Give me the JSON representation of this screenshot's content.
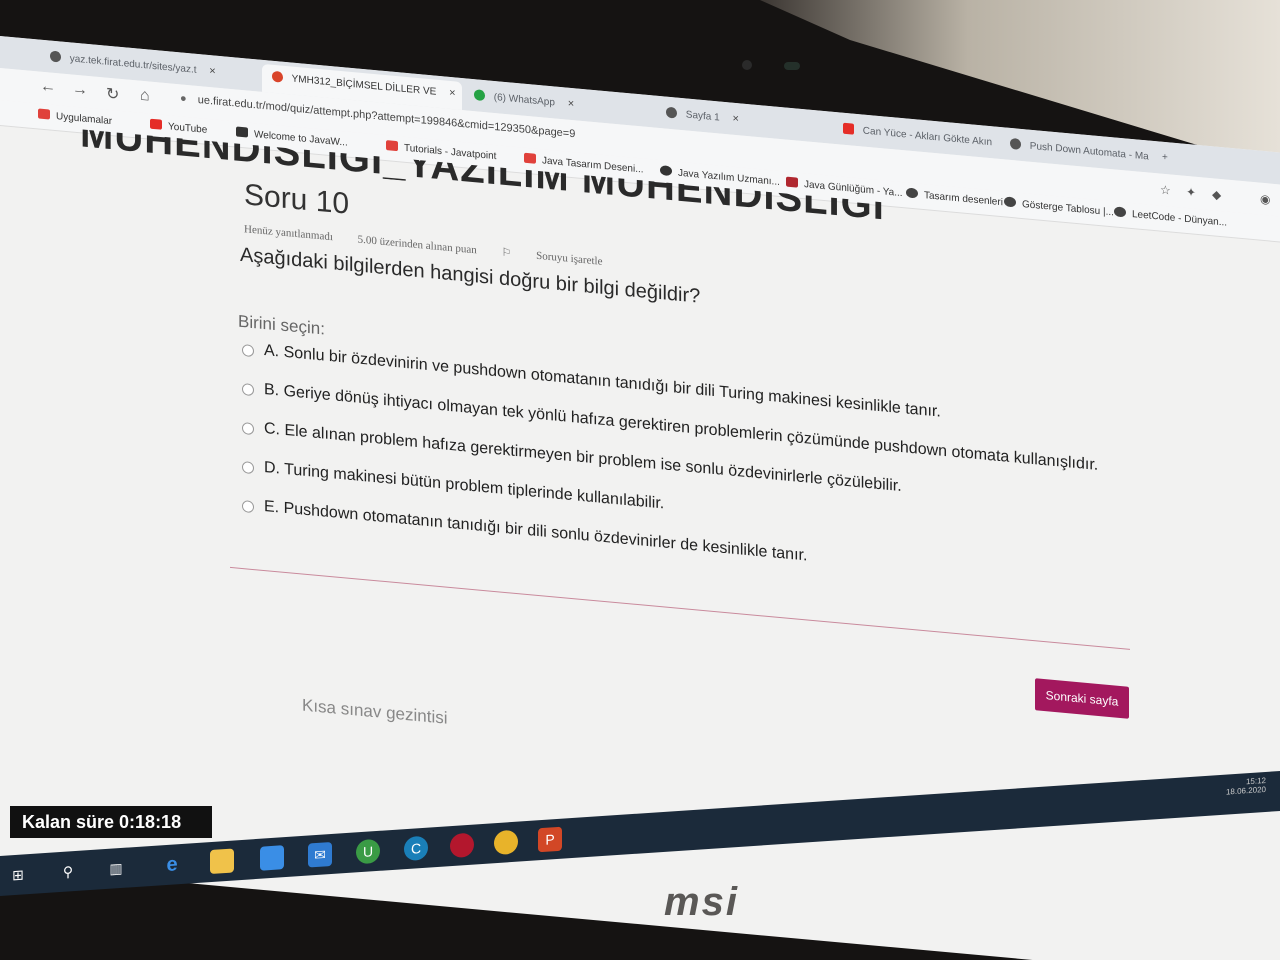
{
  "browser": {
    "tabs": [
      {
        "label": "yaz.tek.firat.edu.tr/sites/yaz.t",
        "active": false
      },
      {
        "label": "YMH312_BİÇİMSEL DİLLER VE",
        "active": true
      },
      {
        "label": "(6) WhatsApp",
        "active": false
      },
      {
        "label": "Sayfa 1",
        "active": false
      },
      {
        "label": "Can Yüce - Akları Gökte Akın",
        "active": false
      },
      {
        "label": "Push Down Automata - Ma",
        "active": false
      }
    ],
    "url": "ue.firat.edu.tr/mod/quiz/attempt.php?attempt=199846&cmid=129350&page=9",
    "bookmarks": [
      "Uygulamalar",
      "YouTube",
      "Welcome to JavaW...",
      "Tutorials - Javatpoint",
      "Java Tasarım Deseni...",
      "Java Yazılım Uzmanı...",
      "Java Günlüğüm - Ya...",
      "Tasarım desenleri",
      "Gösterge Tablosu |...",
      "LeetCode - Dünyan..."
    ]
  },
  "page": {
    "header_partial": "MÜHENDİSLİĞİ_YAZILIM MÜHENDİSLİĞİ",
    "question_number": "Soru 10",
    "status": "Henüz yanıtlanmadı",
    "points": "5.00 üzerinden alınan puan",
    "flag": "Soruyu işaretle",
    "question_text": "Aşağıdaki bilgilerden hangisi doğru bir bilgi değildir?",
    "prompt": "Birini seçin:",
    "answers": [
      "A. Sonlu bir özdevinirin ve pushdown otomatanın tanıdığı bir dili Turing makinesi kesinlikle tanır.",
      "B. Geriye dönüş ihtiyacı olmayan tek yönlü hafıza gerektiren problemlerin çözümünde pushdown otomata kullanışlıdır.",
      "C. Ele alınan problem hafıza gerektirmeyen bir problem ise sonlu özdevinirlerle çözülebilir.",
      "D. Turing makinesi bütün problem tiplerinde kullanılabilir.",
      "E. Pushdown otomatanın tanıdığı bir dili sonlu özdevinirler de kesinlikle tanır."
    ],
    "next_button": "Sonraki sayfa",
    "quiz_navigation": "Kısa sınav gezintisi",
    "timer": "Kalan süre 0:18:18"
  },
  "taskbar": {
    "time": "15:12",
    "date": "18.06.2020"
  },
  "brand": "msi",
  "colors": {
    "accent": "#a3185e",
    "taskbar": "#1b2a3a"
  }
}
